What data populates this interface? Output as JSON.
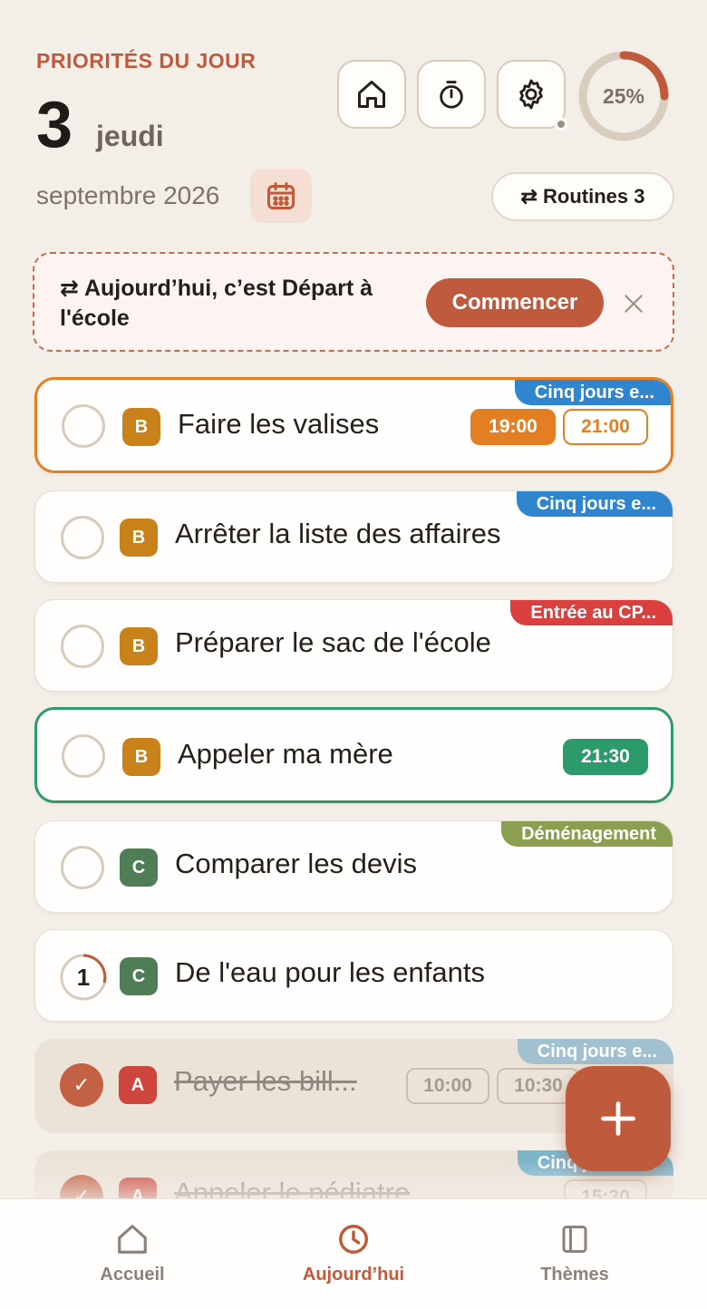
{
  "header": {
    "eyebrow": "PRIORITÉS DU JOUR",
    "day_number": "3",
    "weekday": "jeudi",
    "month_year": "septembre 2026",
    "progress": {
      "label": "25%",
      "value": 0.25
    },
    "routines_label": "⇄ Routines 3"
  },
  "banner": {
    "text": "⇄ Aujourd’hui, c’est Départ à l'école",
    "button": "Commencer"
  },
  "tasks": [
    {
      "title": "Faire les valises",
      "priority": "B",
      "tag": "Cinq jours e...",
      "tag_color": "#2f86cf",
      "times": [
        "19:00",
        "21:00"
      ]
    },
    {
      "title": "Arrêter la liste des affaires",
      "priority": "B",
      "tag": "Cinq jours e...",
      "tag_color": "#2f86cf"
    },
    {
      "title": "Préparer le sac de l'école",
      "priority": "B",
      "tag": "Entrée au CP...",
      "tag_color": "#d9403e"
    },
    {
      "title": "Appeler ma mère",
      "priority": "B",
      "times": [
        "21:30"
      ]
    },
    {
      "title": "Comparer les devis",
      "priority": "C",
      "tag": "Déménagement",
      "tag_color": "#8aa050"
    },
    {
      "title": "De l'eau pour les enfants",
      "priority": "C",
      "step_count": "1"
    },
    {
      "title": "Payer les bill...",
      "priority": "A",
      "tag": "Cinq jours e...",
      "tag_color": "#9dbfd0",
      "times": [
        "10:00",
        "10:30"
      ],
      "done": true,
      "check": "✓"
    },
    {
      "title": "Appeler le pédiatre",
      "priority": "A",
      "tag": "Cinq jours e...",
      "tag_color": "#79b2c9",
      "times": [
        "15:30"
      ],
      "done": true,
      "check": "✓"
    }
  ],
  "nav": {
    "home": "Accueil",
    "today": "Aujourd’hui",
    "themes": "Thèmes"
  },
  "colors": {
    "accent": "#c05a3c",
    "orange": "#e37f22",
    "green": "#2d9a6c",
    "background": "#f3eee8"
  }
}
